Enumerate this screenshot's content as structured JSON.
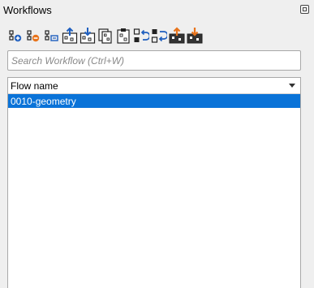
{
  "panel": {
    "title": "Workflows",
    "dock_icon": "float-icon"
  },
  "toolbar": {
    "buttons": [
      {
        "name": "add-workflow-icon",
        "tooltip": "Add workflow"
      },
      {
        "name": "remove-workflow-icon",
        "tooltip": "Remove workflow"
      },
      {
        "name": "rename-workflow-icon",
        "tooltip": "Rename workflow"
      },
      {
        "name": "export-workflow-icon",
        "tooltip": "Export workflow"
      },
      {
        "name": "import-workflow-icon",
        "tooltip": "Import workflow"
      },
      {
        "name": "copy-workflow-icon",
        "tooltip": "Copy workflow"
      },
      {
        "name": "paste-workflow-icon",
        "tooltip": "Paste workflow"
      },
      {
        "name": "move-up-icon",
        "tooltip": "Move up"
      },
      {
        "name": "move-down-icon",
        "tooltip": "Move down"
      },
      {
        "name": "upload-icon",
        "tooltip": "Upload"
      },
      {
        "name": "download-icon",
        "tooltip": "Download"
      }
    ]
  },
  "search": {
    "value": "",
    "placeholder": "Search Workflow (Ctrl+W)"
  },
  "list": {
    "column_header": "Flow name",
    "rows": [
      {
        "label": "0010-geometry",
        "selected": true
      }
    ]
  },
  "colors": {
    "selection": "#0a73d8",
    "accent_orange": "#e8741c",
    "accent_blue": "#1f5fbf"
  }
}
